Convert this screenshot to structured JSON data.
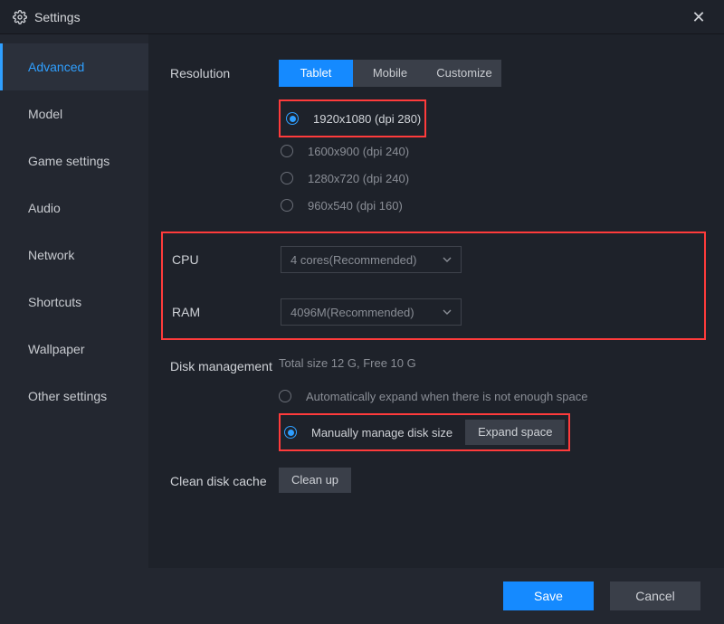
{
  "title": "Settings",
  "sidebar": {
    "items": [
      {
        "label": "Advanced"
      },
      {
        "label": "Model"
      },
      {
        "label": "Game settings"
      },
      {
        "label": "Audio"
      },
      {
        "label": "Network"
      },
      {
        "label": "Shortcuts"
      },
      {
        "label": "Wallpaper"
      },
      {
        "label": "Other settings"
      }
    ]
  },
  "resolution": {
    "label": "Resolution",
    "tabs": {
      "tablet": "Tablet",
      "mobile": "Mobile",
      "customize": "Customize"
    },
    "options": [
      "1920x1080  (dpi 280)",
      "1600x900  (dpi 240)",
      "1280x720  (dpi 240)",
      "960x540  (dpi 160)"
    ]
  },
  "cpu": {
    "label": "CPU",
    "value": "4 cores(Recommended)"
  },
  "ram": {
    "label": "RAM",
    "value": "4096M(Recommended)"
  },
  "disk": {
    "label": "Disk management",
    "info": "Total size 12 G,   Free 10 G",
    "auto": "Automatically expand when there is not enough space",
    "manual": "Manually manage disk size",
    "expand": "Expand space"
  },
  "clean": {
    "label": "Clean disk cache",
    "button": "Clean up"
  },
  "footer": {
    "save": "Save",
    "cancel": "Cancel"
  }
}
